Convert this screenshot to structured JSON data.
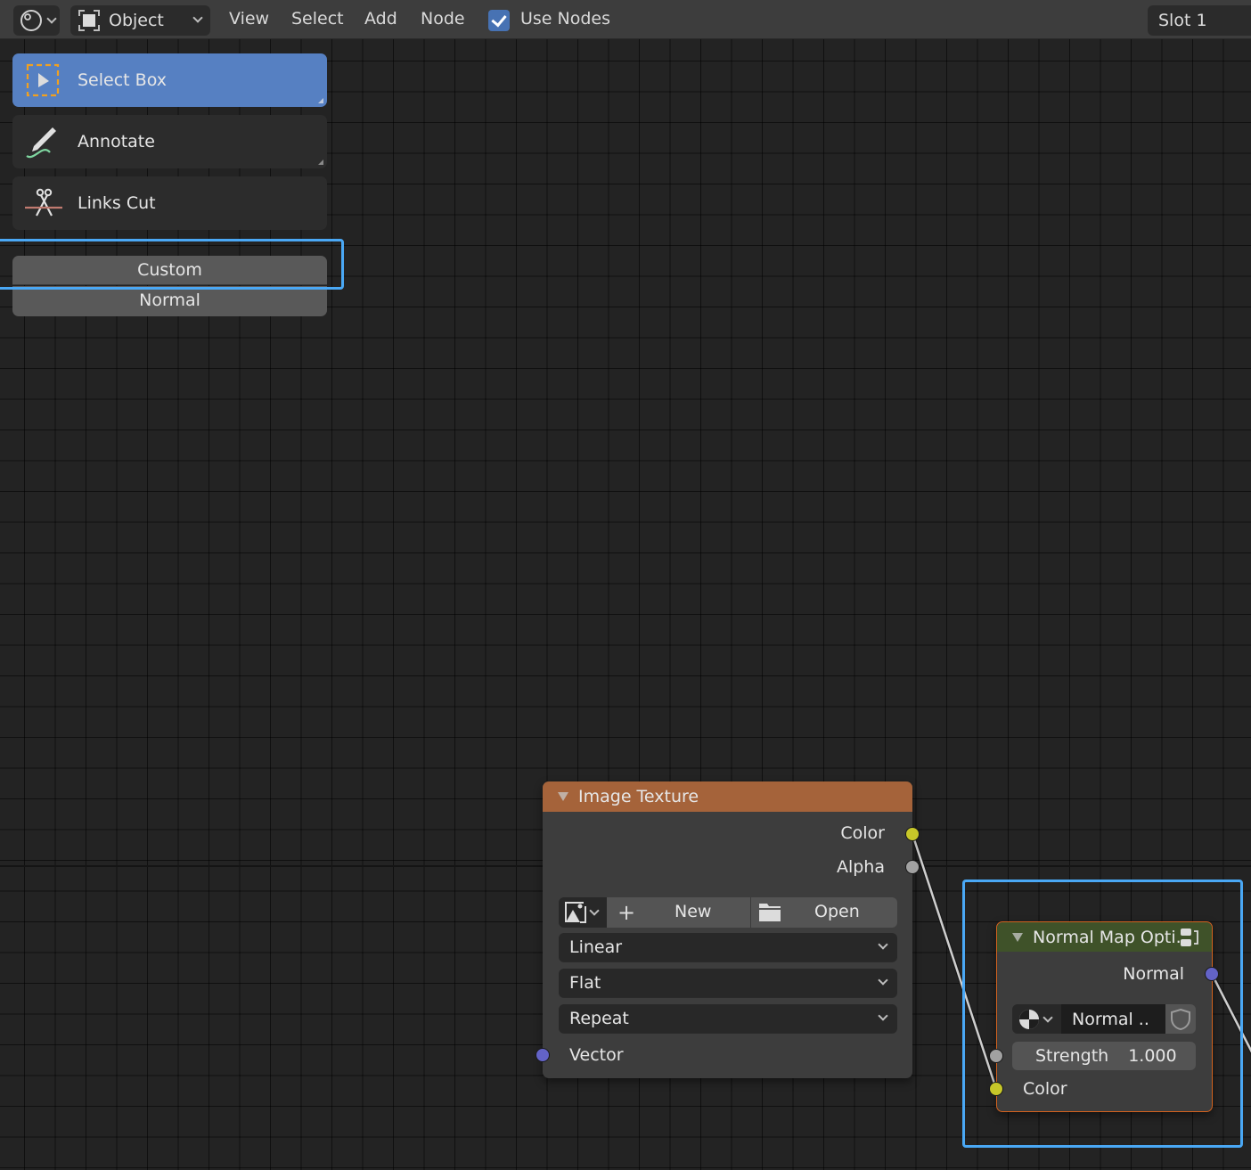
{
  "header": {
    "editor_type_icon": "shader-editor-sphere-icon",
    "object_mode": {
      "icon": "object-mode-icon",
      "label": "Object"
    },
    "menus": [
      "View",
      "Select",
      "Add",
      "Node"
    ],
    "use_nodes": {
      "label": "Use Nodes",
      "checked": true
    },
    "slot": "Slot 1"
  },
  "toolbar": {
    "tools": [
      {
        "label": "Select Box",
        "icon": "select-box-icon",
        "active": true
      },
      {
        "label": "Annotate",
        "icon": "annotate-icon",
        "active": false
      },
      {
        "label": "Links Cut",
        "icon": "links-cut-icon",
        "active": false
      }
    ],
    "toggle": {
      "options": [
        "Custom",
        "Normal"
      ]
    }
  },
  "nodes": {
    "image_texture": {
      "title": "Image Texture",
      "header_color": "#a5633a",
      "outputs": [
        "Color",
        "Alpha"
      ],
      "image_buttons": {
        "new_label": "New",
        "open_label": "Open"
      },
      "interpolation": "Linear",
      "projection": "Flat",
      "extension": "Repeat",
      "inputs": [
        "Vector"
      ]
    },
    "normal_map": {
      "title": "Normal Map Opti.",
      "header_color": "#3f5229",
      "outputs": [
        "Normal"
      ],
      "node_group": "Normal ..",
      "strength": {
        "label": "Strength",
        "value": "1.000"
      },
      "inputs": [
        "Color"
      ]
    }
  },
  "colors": {
    "accent": "#5680c2",
    "selection_outline": "#4aa8f5",
    "socket_color": "#c7c729",
    "socket_float": "#a1a1a1",
    "socket_vector": "#6363c7"
  }
}
